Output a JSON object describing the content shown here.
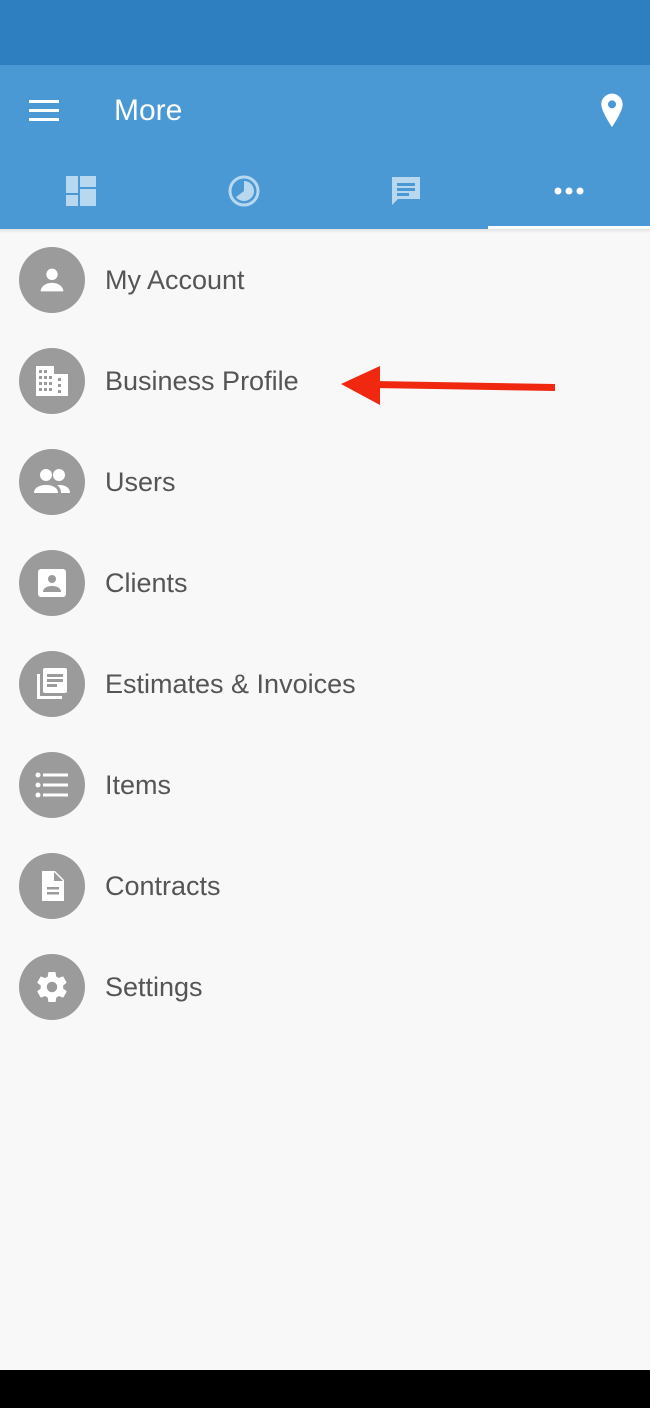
{
  "app_bar": {
    "title": "More",
    "menu_icon": "hamburger-menu-icon",
    "location_icon": "map-pin-icon"
  },
  "tabs": [
    {
      "name": "dashboard",
      "icon": "dashboard-icon",
      "active": false
    },
    {
      "name": "timer",
      "icon": "clock-icon",
      "active": false
    },
    {
      "name": "messages",
      "icon": "chat-icon",
      "active": false
    },
    {
      "name": "more",
      "icon": "more-dots-icon",
      "active": true
    }
  ],
  "menu": {
    "items": [
      {
        "label": "My Account",
        "icon": "person-icon"
      },
      {
        "label": "Business Profile",
        "icon": "building-icon"
      },
      {
        "label": "Users",
        "icon": "group-icon"
      },
      {
        "label": "Clients",
        "icon": "contact-card-icon"
      },
      {
        "label": "Estimates & Invoices",
        "icon": "documents-icon"
      },
      {
        "label": "Items",
        "icon": "list-icon"
      },
      {
        "label": "Contracts",
        "icon": "file-icon"
      },
      {
        "label": "Settings",
        "icon": "gear-icon"
      }
    ]
  },
  "annotation": {
    "type": "arrow",
    "color": "#f0280f",
    "points_to": "Business Profile"
  },
  "colors": {
    "status_bar": "#2e7fbf",
    "app_bar": "#4a98d4",
    "avatar": "#9b9b9b",
    "label_text": "#555555",
    "inactive_tab_icon": "#b8d8f0"
  }
}
